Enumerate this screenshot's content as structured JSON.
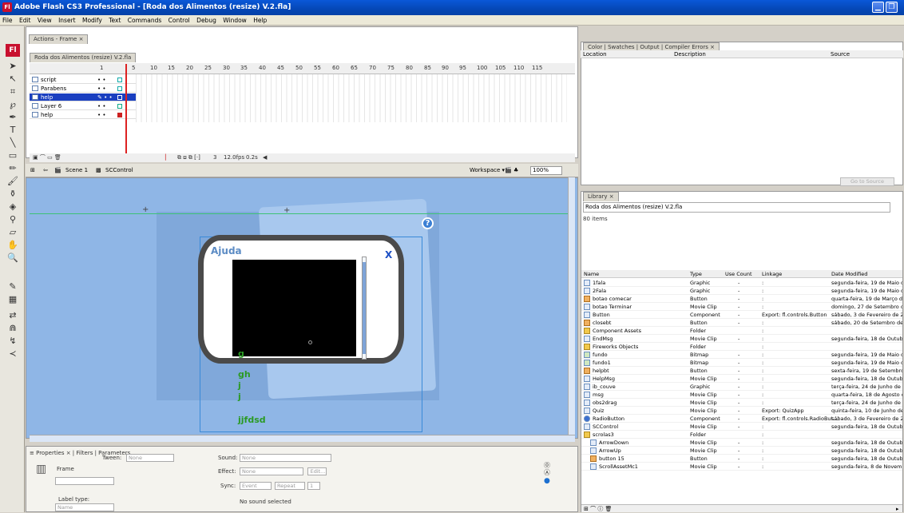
{
  "window": {
    "title": "Adobe Flash CS3 Professional - [Roda dos Alimentos (resize) V.2.fla]",
    "app_icon": "Fl"
  },
  "menu": [
    "File",
    "Edit",
    "View",
    "Insert",
    "Modify",
    "Text",
    "Commands",
    "Control",
    "Debug",
    "Window",
    "Help"
  ],
  "timeline": {
    "actions_tab": "Actions - Frame ×",
    "doc_tab": "Roda dos Alimentos (resize) V.2.fla",
    "ruler": [
      "1",
      "5",
      "10",
      "15",
      "20",
      "25",
      "30",
      "35",
      "40",
      "45",
      "50",
      "55",
      "60",
      "65",
      "70",
      "75",
      "80",
      "85",
      "90",
      "95",
      "100",
      "105",
      "110",
      "115"
    ],
    "layers": [
      {
        "name": "script",
        "selected": false
      },
      {
        "name": "Parabens",
        "selected": false
      },
      {
        "name": "help",
        "selected": true
      },
      {
        "name": "Layer 6",
        "selected": false
      },
      {
        "name": "help",
        "selected": false
      }
    ],
    "frame": "3",
    "fps": "12.0fps",
    "time": "0.2s"
  },
  "scene": {
    "scene_label": "Scene 1",
    "symbol_label": "SCControl",
    "workspace": "Workspace ▾",
    "zoom": "100%"
  },
  "stage": {
    "popup_title": "Ajuda",
    "close_x": "X",
    "green_texts": [
      "g",
      "gh",
      "j",
      "j",
      "jjfdsd"
    ]
  },
  "properties": {
    "tabs": "≡ Properties × | Filters | Parameters",
    "frame_label": "Frame",
    "tween_label": "Tween:",
    "tween_value": "None",
    "sound_label": "Sound:",
    "sound_value": "None",
    "effect_label": "Effect:",
    "effect_value": "None",
    "edit_btn": "Edit...",
    "sync_label": "Sync:",
    "sync_value": "Event",
    "repeat_value": "Repeat",
    "repeat_count": "1",
    "label_type": "Label type:",
    "label_type_value": "Name",
    "no_sound": "No sound selected"
  },
  "errors": {
    "tabs": "Color | Swatches | Output | Compiler Errors ×",
    "cols": [
      "Location",
      "Description",
      "Source"
    ],
    "goto": "Go to Source"
  },
  "library": {
    "tab": "Library ×",
    "doc": "Roda dos Alimentos (resize) V.2.fla",
    "count": "80 items",
    "cols": [
      "Name",
      "Type",
      "Use Count",
      "Linkage",
      "Date Modified"
    ],
    "rows": [
      {
        "name": "1fala",
        "type": "Graphic",
        "use": "-",
        "link": ":",
        "date": "segunda-feira, 19 de Maio de 2("
      },
      {
        "name": "2Fala",
        "type": "Graphic",
        "use": "-",
        "link": ":",
        "date": "segunda-feira, 19 de Maio de 2("
      },
      {
        "name": "botao comecar",
        "type": "Button",
        "use": "-",
        "link": ":",
        "date": "quarta-feira, 19 de Março de 20"
      },
      {
        "name": "botao Terminar",
        "type": "Movie Clip",
        "use": "-",
        "link": ":",
        "date": "domingo, 27 de Setembro de 20"
      },
      {
        "name": "Button",
        "type": "Component",
        "use": "-",
        "link": "Export: fl.controls.Button",
        "date": "sábado, 3 de Fevereiro de 2007"
      },
      {
        "name": "closebt",
        "type": "Button",
        "use": "-",
        "link": ":",
        "date": "sábado, 20 de Setembro de 200"
      },
      {
        "name": "Component Assets",
        "type": "Folder",
        "use": "",
        "link": ":",
        "date": ""
      },
      {
        "name": "EndMsg",
        "type": "Movie Clip",
        "use": "-",
        "link": ":",
        "date": "segunda-feira, 18 de Outubro d"
      },
      {
        "name": "Fireworks Objects",
        "type": "Folder",
        "use": "",
        "link": ":",
        "date": ""
      },
      {
        "name": "fundo",
        "type": "Bitmap",
        "use": "-",
        "link": ":",
        "date": "segunda-feira, 19 de Maio de 2("
      },
      {
        "name": "fundo1",
        "type": "Bitmap",
        "use": "-",
        "link": ":",
        "date": "segunda-feira, 19 de Maio de 2("
      },
      {
        "name": "helpbt",
        "type": "Button",
        "use": "-",
        "link": ":",
        "date": "sexta-feira, 19 de Setembro de"
      },
      {
        "name": "HelpMsg",
        "type": "Movie Clip",
        "use": "-",
        "link": ":",
        "date": "segunda-feira, 18 de Outubro d"
      },
      {
        "name": "ib_couve",
        "type": "Graphic",
        "use": "-",
        "link": ":",
        "date": "terça-feira, 24 de Junho de 200"
      },
      {
        "name": "msg",
        "type": "Movie Clip",
        "use": "-",
        "link": ":",
        "date": "quarta-feira, 18 de Agosto de 2"
      },
      {
        "name": "obs2drag",
        "type": "Movie Clip",
        "use": "-",
        "link": ":",
        "date": "terça-feira, 24 de Junho de 200"
      },
      {
        "name": "Quiz",
        "type": "Movie Clip",
        "use": "-",
        "link": "Export: QuizApp",
        "date": "quinta-feira, 10 de Junho de 20"
      },
      {
        "name": "RadioButton",
        "type": "Component",
        "use": "-",
        "link": "Export: fl.controls.RadioBut...",
        "date": "sábado, 3 de Fevereiro de 2007"
      },
      {
        "name": "SCControl",
        "type": "Movie Clip",
        "use": "-",
        "link": ":",
        "date": "segunda-feira, 18 de Outubro d"
      },
      {
        "name": "scrolas3",
        "type": "Folder",
        "use": "",
        "link": ":",
        "date": ""
      },
      {
        "name": "ArrowDown",
        "type": "Movie Clip",
        "use": "-",
        "link": ":",
        "date": "segunda-feira, 18 de Outubro d"
      },
      {
        "name": "ArrowUp",
        "type": "Movie Clip",
        "use": "-",
        "link": ":",
        "date": "segunda-feira, 18 de Outubro d"
      },
      {
        "name": "button 15",
        "type": "Button",
        "use": "-",
        "link": ":",
        "date": "segunda-feira, 18 de Outubro d"
      },
      {
        "name": "ScrollAssetMc1",
        "type": "Movie Clip",
        "use": "-",
        "link": ":",
        "date": "segunda-feira, 8 de Novembro c"
      }
    ]
  }
}
